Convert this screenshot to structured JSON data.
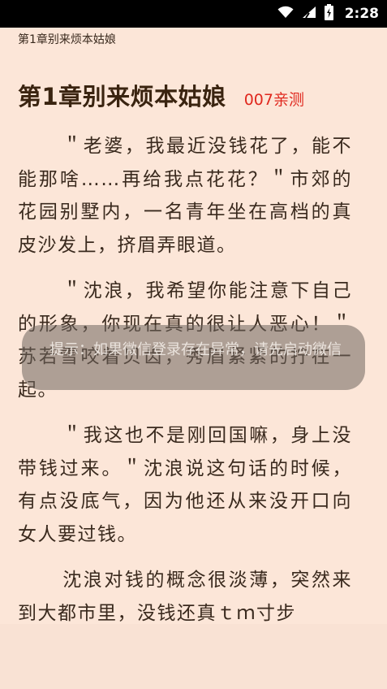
{
  "status_bar": {
    "time": "2:28",
    "icons": [
      "wifi-icon",
      "signal-icon",
      "battery-charging-icon"
    ]
  },
  "reader": {
    "chapter_header": "第1章别来烦本姑娘",
    "title": "第1章别来烦本姑娘",
    "tag": "007亲测",
    "paragraphs": [
      "＂老婆，我最近没钱花了，能不能那啥……再给我点花花？＂市郊的花园别墅内，一名青年坐在高档的真皮沙发上，挤眉弄眼道。",
      "＂沈浪，我希望你能注意下自己的形象，你现在真的很让人恶心！＂苏若雪咬着贝齿，秀眉紧紧的拧在一起。",
      "＂我这也不是刚回国嘛，身上没带钱过来。＂沈浪说这句话的时候，有点没底气，因为他还从来没开口向女人要过钱。",
      "沈浪对钱的概念很淡薄，突然来到大都市里，没钱还真ｔｍ寸步"
    ]
  },
  "toast": {
    "text": "提示：如果微信登录存在异常，请先启动微信"
  },
  "colors": {
    "background": "#fce6d8",
    "tag": "#e0281e",
    "status_bar": "#000000"
  }
}
